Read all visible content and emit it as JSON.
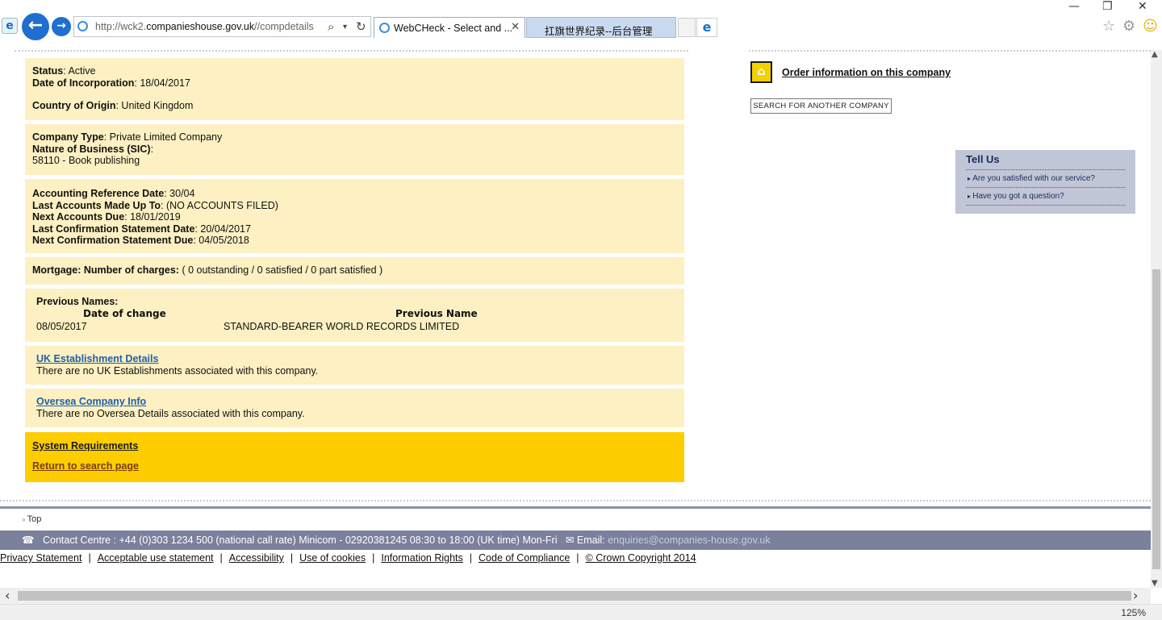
{
  "browser": {
    "url_prefix": "http://wck2.",
    "url_domain": "companieshouse.gov.uk",
    "url_suffix": "//compdetails",
    "tabs": [
      {
        "label": "WebCHeck - Select and ..."
      },
      {
        "label": "扛旗世界纪录--后台管理"
      }
    ],
    "zoom": "125%"
  },
  "details": {
    "status_label": "Status",
    "status_value": ": Active",
    "incorp_label": "Date of Incorporation",
    "incorp_value": ": 18/04/2017",
    "origin_label": "Country of Origin",
    "origin_value": ": United Kingdom",
    "type_label": "Company Type",
    "type_value": ": Private Limited Company",
    "sic_label": "Nature of Business (SIC)",
    "sic_value": ":",
    "sic_code": "58110 - Book publishing",
    "ard_label": "Accounting Reference Date",
    "ard_value": ": 30/04",
    "lamu_label": "Last Accounts Made Up To",
    "lamu_value": ":  (NO ACCOUNTS FILED)",
    "nad_label": "Next Accounts Due",
    "nad_value": ": 18/01/2019",
    "lcsd_label": "Last Confirmation Statement Date",
    "lcsd_value": ": 20/04/2017",
    "ncsd_label": "Next Confirmation Statement Due",
    "ncsd_value": ": 04/05/2018",
    "mortgage_label": "Mortgage: Number of charges:",
    "mortgage_value": "( 0 outstanding / 0 satisfied / 0 part satisfied )",
    "prev_title": "Previous Names:",
    "prev_col_date": "Date of change",
    "prev_col_name": "Previous Name",
    "prev_rows": [
      {
        "date": "08/05/2017",
        "name": "STANDARD-BEARER WORLD RECORDS LIMITED"
      }
    ],
    "uk_link": "UK Establishment Details",
    "uk_text": "There are no UK Establishments associated with this company.",
    "oversea_link": "Oversea Company Info",
    "oversea_text": "There are no Oversea Details associated with this company.",
    "sysreq_link": "System Requirements",
    "return_link": "Return to search page"
  },
  "sidebar": {
    "order_link": "Order information on this company",
    "search_button": "SEARCH FOR ANOTHER COMPANY",
    "tellus_title": "Tell Us",
    "tellus_items": [
      {
        "label": "Are you satisfied with our service?"
      },
      {
        "label": "Have you got a question?"
      }
    ]
  },
  "footer": {
    "top_link": "Top",
    "contact": "Contact Centre : +44 (0)303 1234 500 (national call rate)   Minicom - 02920381245 08:30 to 18:00 (UK time) Mon-Fri",
    "email_label": "Email:",
    "email": "enquiries@companies-house.gov.uk",
    "links": [
      {
        "label": "Privacy Statement"
      },
      {
        "label": "Acceptable use statement"
      },
      {
        "label": "Accessibility"
      },
      {
        "label": "Use of cookies"
      },
      {
        "label": "Information Rights"
      },
      {
        "label": "Code of Compliance"
      },
      {
        "label": "© Crown Copyright 2014"
      }
    ]
  }
}
